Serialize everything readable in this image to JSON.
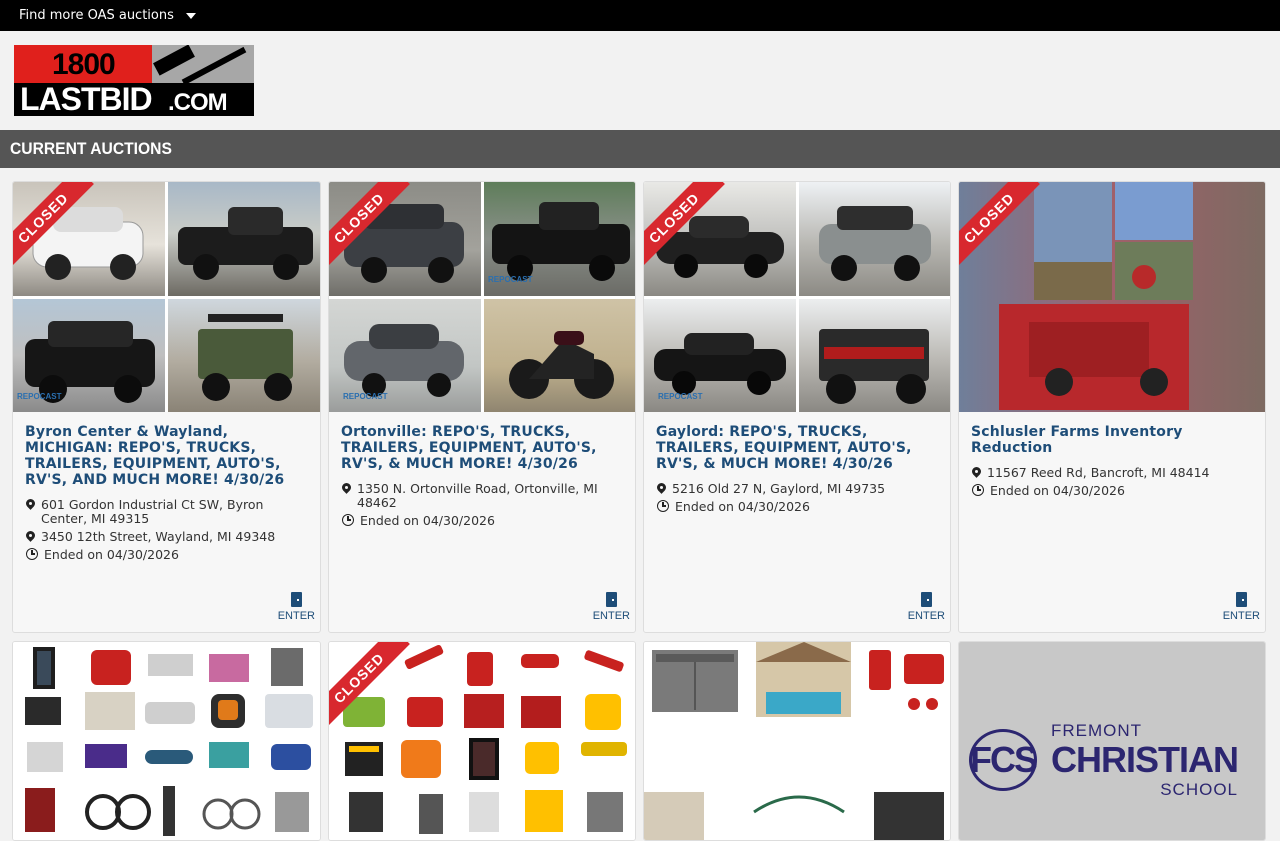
{
  "topbar": {
    "find_more": "Find more OAS auctions"
  },
  "logo": {
    "line1": "1800",
    "line2_a": "LAST",
    "line2_b": "BID",
    "line2_c": ".COM"
  },
  "section": {
    "title": "CURRENT AUCTIONS"
  },
  "enter_label": "ENTER",
  "closed_label": "CLOSED",
  "auctions": [
    {
      "title": "Byron Center & Wayland, MICHIGAN: REPO'S, TRUCKS, TRAILERS, EQUIPMENT, AUTO'S, RV'S, AND MUCH MORE! 4/30/26",
      "addresses": [
        "601 Gordon Industrial Ct SW, Byron Center, MI 49315",
        "3450 12th Street, Wayland, MI 49348"
      ],
      "ended": "Ended on 04/30/2026",
      "closed": true
    },
    {
      "title": "Ortonville: REPO'S, TRUCKS, TRAILERS, EQUIPMENT, AUTO'S, RV'S, & MUCH MORE! 4/30/26",
      "addresses": [
        "1350 N. Ortonville Road, Ortonville, MI 48462"
      ],
      "ended": "Ended on 04/30/2026",
      "closed": true
    },
    {
      "title": "Gaylord: REPO'S, TRUCKS, TRAILERS, EQUIPMENT, AUTO'S, RV'S, & MUCH MORE! 4/30/26",
      "addresses": [
        "5216 Old 27 N, Gaylord, MI 49735"
      ],
      "ended": "Ended on 04/30/2026",
      "closed": true
    },
    {
      "title": "Schlusler Farms Inventory Reduction",
      "addresses": [
        "11567 Reed Rd, Bancroft, MI 48414"
      ],
      "ended": "Ended on 04/30/2026",
      "closed": true
    }
  ],
  "fcs": {
    "mark": "FCS",
    "line1": "FREMONT",
    "line2": "CHRISTIAN",
    "line3": "SCHOOL"
  },
  "colors": {
    "title_blue": "#1e4d78",
    "ribbon_red": "#d8282e",
    "section_gray": "#555555"
  }
}
